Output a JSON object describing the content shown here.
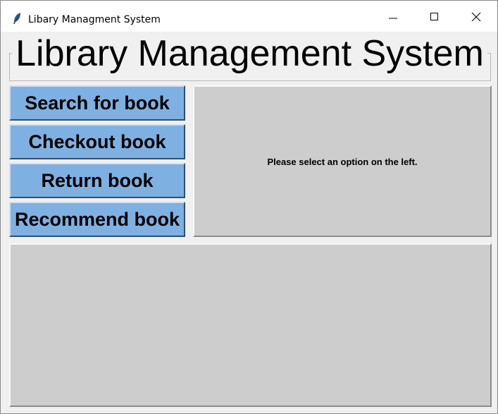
{
  "window": {
    "title": "Libary Managment System",
    "icon": "feather-icon",
    "controls": {
      "minimize": "minimize-icon",
      "maximize": "maximize-icon",
      "close": "close-icon"
    }
  },
  "header": {
    "title": "Library Management System"
  },
  "menu": {
    "items": [
      {
        "label": "Search for book"
      },
      {
        "label": "Checkout book"
      },
      {
        "label": "Return book"
      },
      {
        "label": "Recommend book"
      }
    ]
  },
  "info_panel": {
    "message": "Please select an option on the left."
  },
  "output_panel": {
    "content": ""
  },
  "colors": {
    "button_bg": "#7fb0e2",
    "panel_bg": "#cdcdcd",
    "window_bg": "#f0f0f0"
  }
}
